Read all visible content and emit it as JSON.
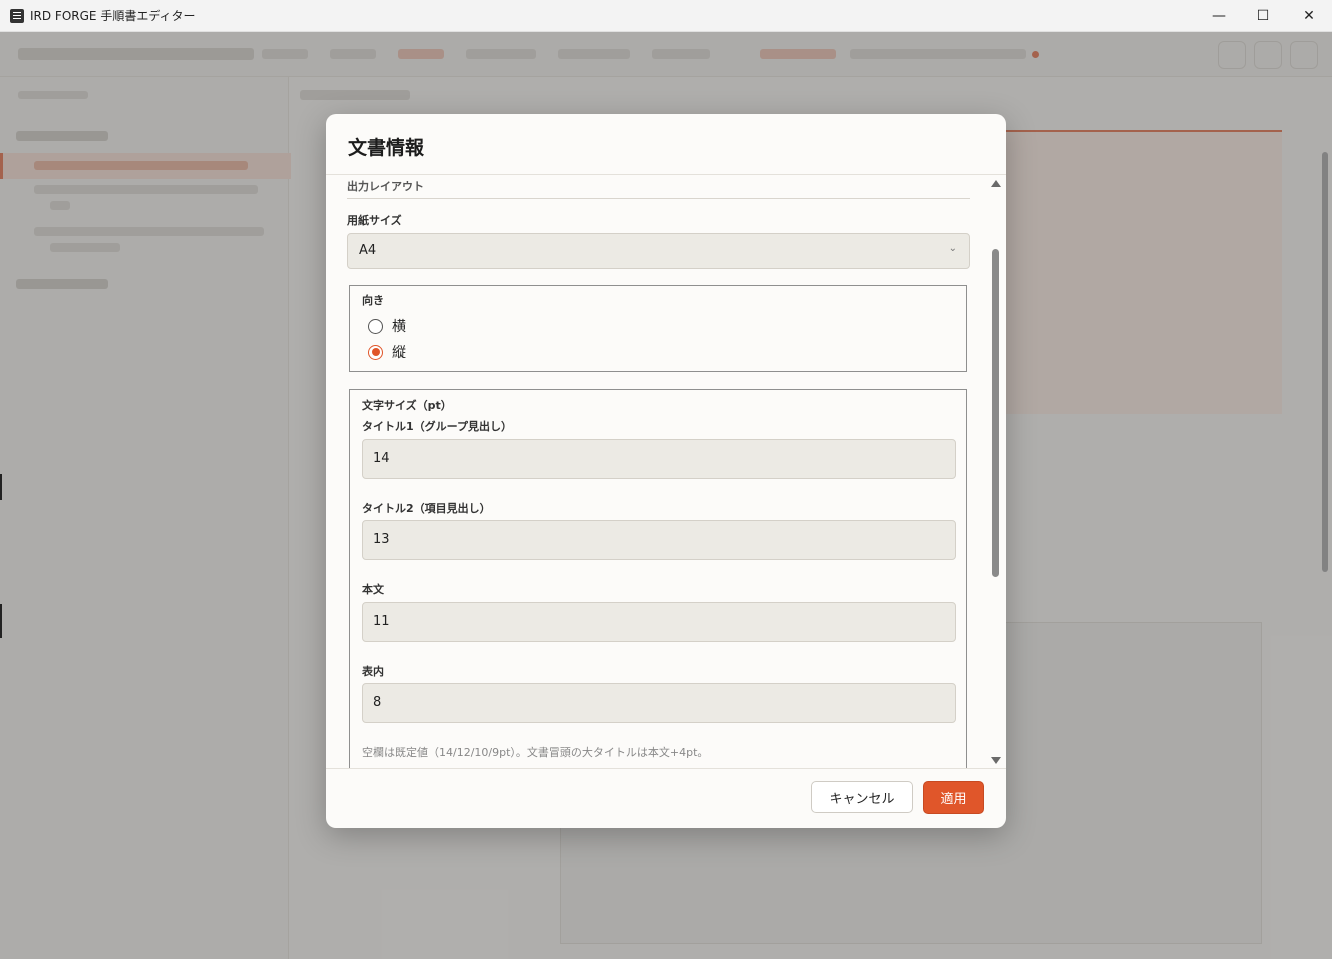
{
  "window": {
    "title": "IRD FORGE 手順書エディター",
    "minimize_glyph": "—",
    "maximize_glyph": "☐",
    "close_glyph": "✕"
  },
  "dialog": {
    "title": "文書情報",
    "section_label": "出力レイアウト",
    "paper_size": {
      "label": "用紙サイズ",
      "value": "A4"
    },
    "orientation": {
      "legend": "向き",
      "options": [
        {
          "label": "横",
          "checked": false
        },
        {
          "label": "縦",
          "checked": true
        }
      ]
    },
    "font_size": {
      "legend": "文字サイズ（pt）",
      "fields": [
        {
          "label": "タイトル1（グループ見出し）",
          "value": "14"
        },
        {
          "label": "タイトル2（項目見出し）",
          "value": "13"
        },
        {
          "label": "本文",
          "value": "11"
        },
        {
          "label": "表内",
          "value": "8"
        }
      ],
      "hint": "空欄は既定値（14/12/10/9pt）。文書冒頭の大タイトルは本文+4pt。"
    },
    "buttons": {
      "cancel": "キャンセル",
      "apply": "適用"
    }
  },
  "colors": {
    "accent": "#e0562a"
  }
}
